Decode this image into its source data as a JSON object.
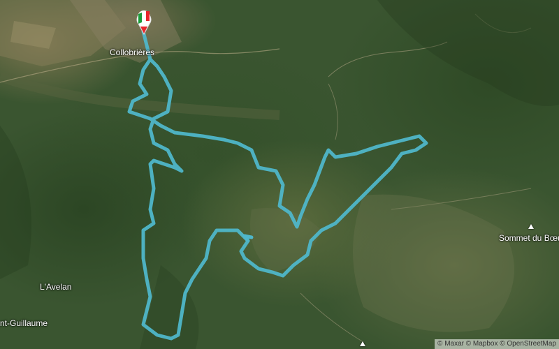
{
  "map": {
    "imagery": "satellite",
    "route_color": "#4fb6c9",
    "start_marker_icon": "start-flag-pin",
    "start_marker_colors": [
      "#1a9c3a",
      "#ffffff",
      "#e8262c"
    ],
    "places": [
      {
        "id": "collobrieres",
        "label": "Collobrières"
      },
      {
        "id": "avelan",
        "label": "L'Avelan"
      },
      {
        "id": "saint-guillaume",
        "label": "nt-Guillaume"
      }
    ],
    "peaks": [
      {
        "id": "sommet-du-boeuf",
        "label": "Sommet du Bœu",
        "icon": "mountain-peak-icon"
      },
      {
        "id": "peak-bottom",
        "label": "",
        "icon": "mountain-peak-icon"
      }
    ]
  },
  "attribution": {
    "text": "© Maxar © Mapbox © OpenStreetMap"
  }
}
